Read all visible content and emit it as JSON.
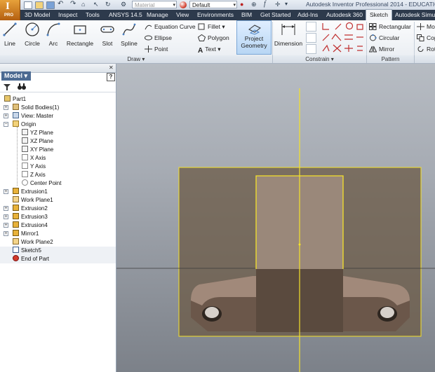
{
  "app": {
    "logo_letter": "I",
    "logo_sub": "PRO",
    "title": "Autodesk Inventor Professional 2014 - EDUCATIONA",
    "material_placeholder": "Material",
    "appearance_value": "Default"
  },
  "menu_tabs": [
    "3D Model",
    "Inspect",
    "Tools",
    "ANSYS 14.5",
    "Manage",
    "View",
    "Environments",
    "BIM",
    "Get Started",
    "Add-Ins",
    "Autodesk 360",
    "Sketch",
    "Autodesk Simul"
  ],
  "active_tab": "Sketch",
  "ribbon": {
    "draw": {
      "line": "Line",
      "circle": "Circle",
      "arc": "Arc",
      "rectangle": "Rectangle",
      "slot": "Slot",
      "spline": "Spline",
      "equation_curve": "Equation Curve",
      "ellipse": "Ellipse",
      "point": "Point",
      "fillet": "Fillet",
      "polygon": "Polygon",
      "text": "Text",
      "project_geometry_line1": "Project",
      "project_geometry_line2": "Geometry",
      "panel_label": "Draw"
    },
    "constrain": {
      "dimension": "Dimension",
      "panel_label": "Constrain"
    },
    "pattern": {
      "rectangular": "Rectangular",
      "circular": "Circular",
      "mirror": "Mirror",
      "panel_label": "Pattern"
    },
    "modify": {
      "move": "Mo",
      "copy": "Cop",
      "rotate": "Rot"
    }
  },
  "browser": {
    "title": "Model",
    "help": "?",
    "tree": [
      {
        "label": "Part1",
        "level": 0,
        "icon": "part-icon"
      },
      {
        "label": "Solid Bodies(1)",
        "level": 1,
        "icon": "solid-bodies-icon",
        "expand": true
      },
      {
        "label": "View: Master",
        "level": 1,
        "icon": "view-icon",
        "expand": true
      },
      {
        "label": "Origin",
        "level": 1,
        "icon": "origin-folder-icon",
        "expand": true
      },
      {
        "label": "YZ Plane",
        "level": 2,
        "icon": "plane-icon"
      },
      {
        "label": "XZ Plane",
        "level": 2,
        "icon": "plane-icon"
      },
      {
        "label": "XY Plane",
        "level": 2,
        "icon": "plane-icon"
      },
      {
        "label": "X Axis",
        "level": 2,
        "icon": "axis-icon"
      },
      {
        "label": "Y Axis",
        "level": 2,
        "icon": "axis-icon"
      },
      {
        "label": "Z Axis",
        "level": 2,
        "icon": "axis-icon"
      },
      {
        "label": "Center Point",
        "level": 2,
        "icon": "center-point-icon"
      },
      {
        "label": "Extrusion1",
        "level": 1,
        "icon": "extrusion-icon",
        "expand": true
      },
      {
        "label": "Work Plane1",
        "level": 1,
        "icon": "work-plane-icon"
      },
      {
        "label": "Extrusion2",
        "level": 1,
        "icon": "extrusion-icon",
        "expand": true
      },
      {
        "label": "Extrusion3",
        "level": 1,
        "icon": "extrusion-icon",
        "expand": true
      },
      {
        "label": "Extrusion4",
        "level": 1,
        "icon": "extrusion-icon",
        "expand": true
      },
      {
        "label": "Mirror1",
        "level": 1,
        "icon": "mirror-icon",
        "expand": true
      },
      {
        "label": "Work Plane2",
        "level": 1,
        "icon": "work-plane-icon"
      },
      {
        "label": "Sketch5",
        "level": 1,
        "icon": "sketch-icon"
      },
      {
        "label": "End of Part",
        "level": 1,
        "icon": "end-of-part-icon"
      }
    ]
  },
  "colors": {
    "menu_bg": "#2d3a4c",
    "sketch_line": "#f5e22a",
    "part_face": "#8a7563",
    "part_dark": "#5a4a3e"
  }
}
